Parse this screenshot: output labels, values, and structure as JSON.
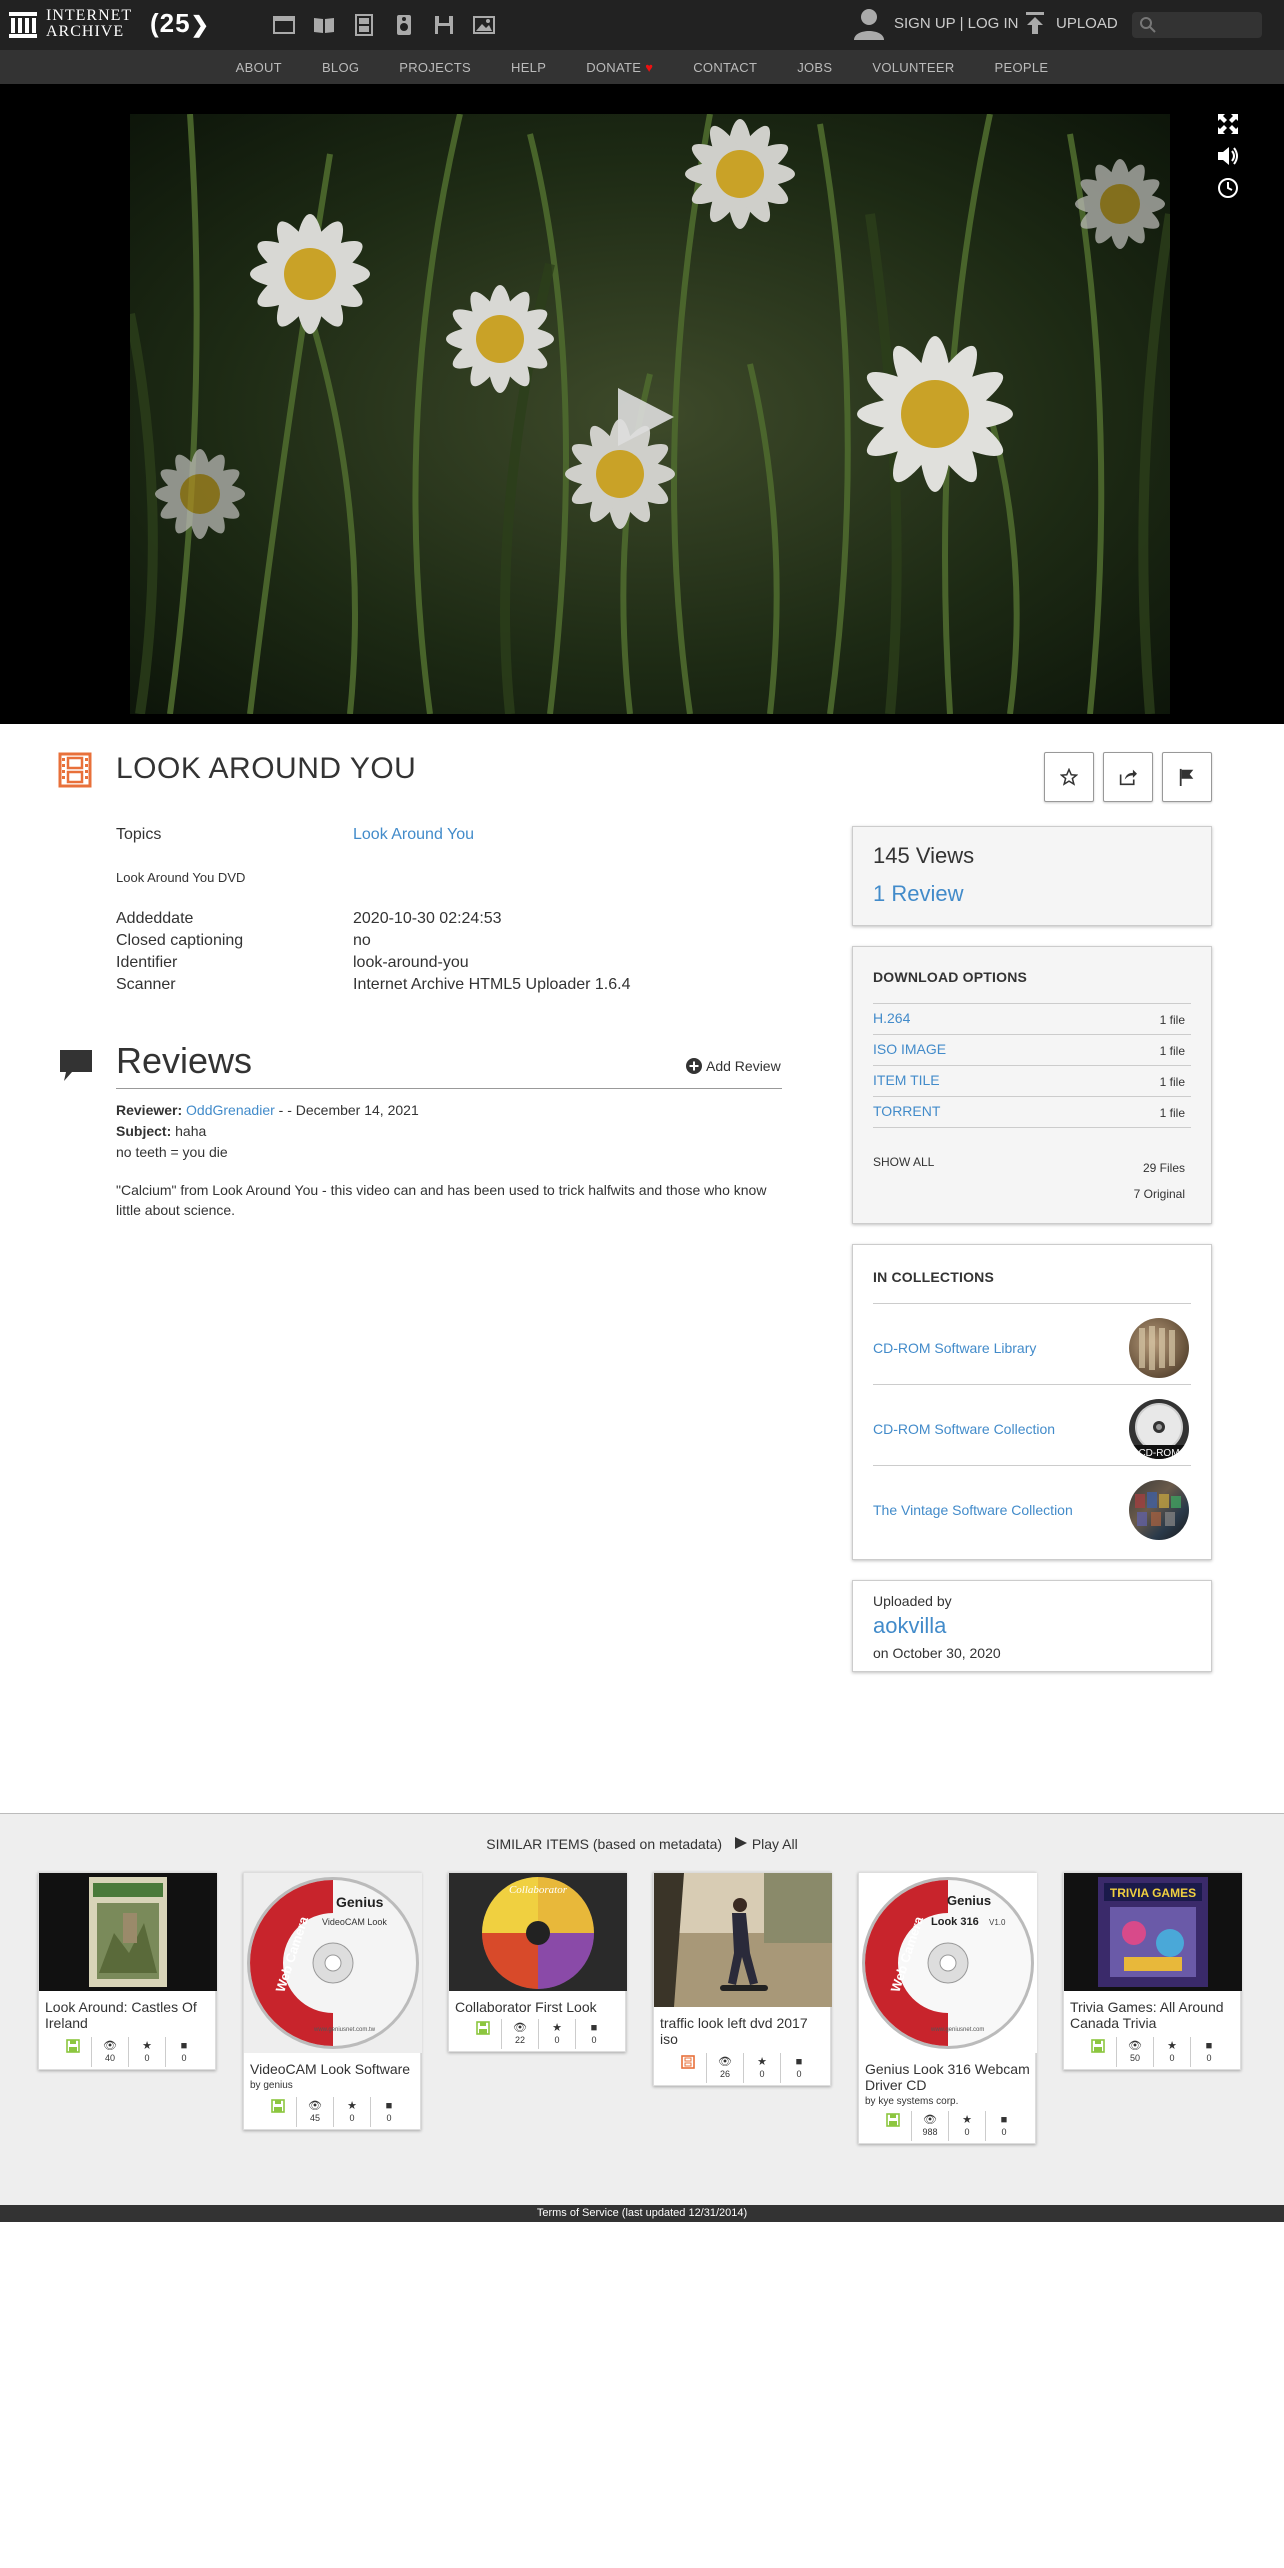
{
  "header": {
    "logo_line1": "INTERNET",
    "logo_line2": "ARCHIVE",
    "anniversary": "(25",
    "media_icons": [
      "web-icon",
      "texts-icon",
      "video-icon",
      "audio-icon",
      "software-icon",
      "images-icon"
    ],
    "signup_login": "SIGN UP | LOG IN",
    "upload": "UPLOAD",
    "search_placeholder": "Search"
  },
  "nav": {
    "items": [
      "ABOUT",
      "BLOG",
      "PROJECTS",
      "HELP",
      "DONATE",
      "CONTACT",
      "JOBS",
      "VOLUNTEER",
      "PEOPLE"
    ],
    "donate_heart": "♥"
  },
  "item": {
    "title": "LOOK AROUND YOU",
    "topics_label": "Topics",
    "topics_value": "Look Around You",
    "description": "Look Around You DVD",
    "metadata": [
      {
        "label": "Addeddate",
        "value": "2020-10-30 02:24:53"
      },
      {
        "label": "Closed captioning",
        "value": "no"
      },
      {
        "label": "Identifier",
        "value": "look-around-you"
      },
      {
        "label": "Scanner",
        "value": "Internet Archive HTML5 Uploader 1.6.4"
      }
    ]
  },
  "reviews": {
    "title": "Reviews",
    "add_review": "Add Review",
    "reviewer_label": "Reviewer:",
    "reviewer_name": "OddGrenadier",
    "reviewer_suffix": " - - December 14, 2021",
    "subject_label": "Subject:",
    "subject_value": " haha",
    "line1": "no teeth = you die",
    "body": "\"Calcium\" from Look Around You - this video can and has been used to trick halfwits and those who know little about science."
  },
  "stats_box": {
    "views": "145 Views",
    "review_count": "1 Review"
  },
  "downloads": {
    "heading": "DOWNLOAD OPTIONS",
    "rows": [
      {
        "name": "H.264",
        "count": "1 file"
      },
      {
        "name": "ISO IMAGE",
        "count": "1 file"
      },
      {
        "name": "ITEM TILE",
        "count": "1 file"
      },
      {
        "name": "TORRENT",
        "count": "1 file"
      }
    ],
    "show_all": "SHOW ALL",
    "files": "29 Files",
    "original": "7 Original"
  },
  "collections": {
    "heading": "IN COLLECTIONS",
    "rows": [
      {
        "name": "CD-ROM Software Library"
      },
      {
        "name": "CD-ROM Software Collection",
        "thumb_text": "CD-ROM"
      },
      {
        "name": "The Vintage Software Collection"
      }
    ]
  },
  "uploader": {
    "label": "Uploaded by",
    "name": "aokvilla",
    "date": "on October 30, 2020"
  },
  "similar": {
    "title": "SIMILAR ITEMS (based on metadata)",
    "play_all": "Play All",
    "tiles": [
      {
        "name": "Look Around: Castles Of Ireland",
        "by": "",
        "views": "40",
        "favs": "0",
        "reviews": "0",
        "type": "software"
      },
      {
        "name": "VideoCAM Look Software",
        "by": "by genius",
        "views": "45",
        "favs": "0",
        "reviews": "0",
        "type": "software",
        "disc_brand": "Genius",
        "disc_title": "VideoCAM Look",
        "disc_side": "Web Camera",
        "disc_url": "www.geniusnet.com.tw"
      },
      {
        "name": "Collaborator First Look",
        "by": "",
        "views": "22",
        "favs": "0",
        "reviews": "0",
        "type": "software",
        "cover_text": "Collaborator"
      },
      {
        "name": "traffic look left dvd 2017 iso",
        "by": "",
        "views": "26",
        "favs": "0",
        "reviews": "0",
        "type": "movie"
      },
      {
        "name": "Genius Look 316 Webcam Driver CD",
        "by": "by kye systems corp.",
        "views": "988",
        "favs": "0",
        "reviews": "0",
        "type": "software",
        "disc_brand": "Genius",
        "disc_title": "Look 316",
        "disc_version": "V1.0",
        "disc_side": "Web Camera",
        "disc_url": "www.geniusnet.com"
      },
      {
        "name": "Trivia Games: All Around Canada Trivia",
        "by": "",
        "views": "50",
        "favs": "0",
        "reviews": "0",
        "type": "software",
        "cover_text": "TRIVIA GAMES"
      }
    ]
  },
  "footer": {
    "text": "Terms of Service (last updated 12/31/2014)"
  },
  "colors": {
    "link": "#428bca",
    "topbar": "#222222",
    "accent_orange": "#e8703a",
    "software_green": "#8cc63f"
  }
}
